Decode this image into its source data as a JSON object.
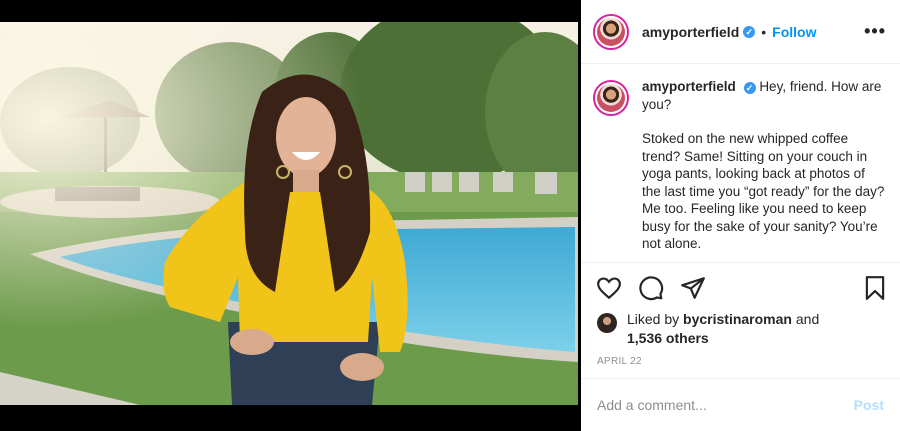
{
  "post": {
    "username": "amyporterfield",
    "verified_mark": "✓",
    "separator": "•",
    "follow_label": "Follow",
    "more_label": "•••",
    "caption_greeting": "Hey, friend. How are you?",
    "caption_body": "Stoked on the new whipped coffee trend? Same! Sitting on your couch in yoga pants, looking back at photos of the last time you “got ready” for the day? Me too. Feeling like you need to keep busy for the sake of your sanity? You’re not alone.",
    "liked_by_prefix": "Liked by",
    "liked_by_user": "bycristinaroman",
    "liked_by_and": "and",
    "others_label": "1,536 others",
    "date": "April 22",
    "comment_placeholder": "Add a comment...",
    "post_label": "Post"
  },
  "icons": {
    "like": "heart-icon",
    "comment": "comment-icon",
    "share": "paper-plane-icon",
    "save": "bookmark-icon"
  },
  "colors": {
    "link_blue": "#0095f6",
    "post_disabled": "#b2dffc",
    "verified": "#3897f0",
    "shirt_yellow": "#f1c419",
    "pool": "#4fb7d9"
  }
}
